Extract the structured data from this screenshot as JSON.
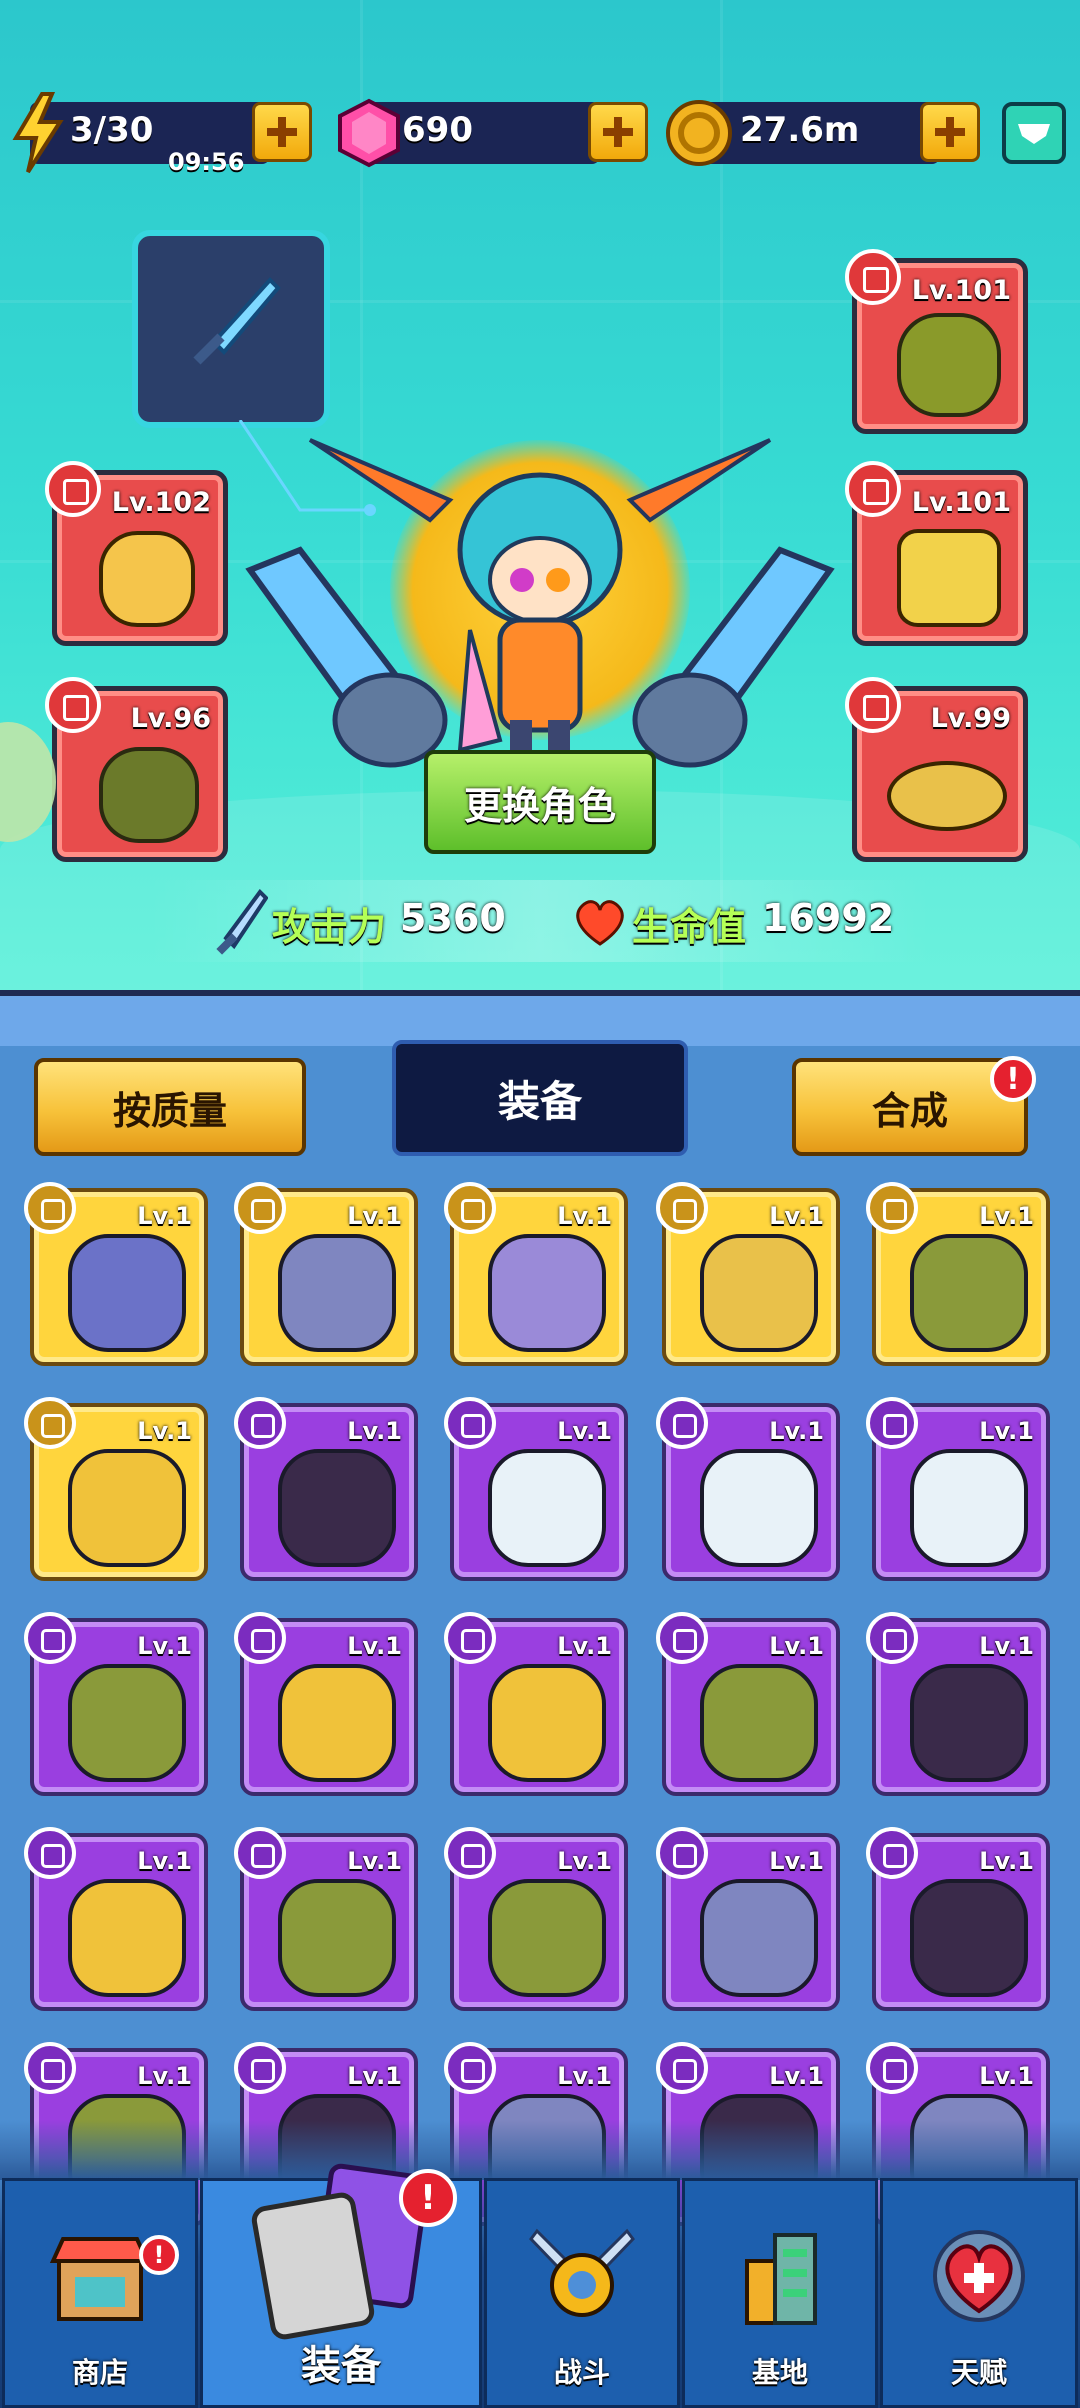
{
  "resources": {
    "energy": {
      "value": "3/30",
      "timer": "09:56",
      "icon": "lightning-icon"
    },
    "gems": {
      "value": "690",
      "icon": "gem-icon"
    },
    "coins": {
      "value": "27.6m",
      "icon": "coin-icon"
    }
  },
  "hero": {
    "weapon_slot_icon": "sword-icon",
    "equipped_slots": [
      {
        "slot": "necklace",
        "level": "Lv.102",
        "icon": "scarf-icon"
      },
      {
        "slot": "gloves",
        "level": "Lv.96",
        "icon": "glove-icon"
      },
      {
        "slot": "armor",
        "level": "Lv.101",
        "icon": "armor-icon"
      },
      {
        "slot": "pants",
        "level": "Lv.101",
        "icon": "shorts-icon"
      },
      {
        "slot": "shoes",
        "level": "Lv.99",
        "icon": "sandal-icon"
      }
    ],
    "change_button": "更换角色",
    "stats": {
      "attack_label": "攻击力",
      "attack_value": "5360",
      "hp_label": "生命值",
      "hp_value": "16992"
    }
  },
  "tabs": {
    "sort_button": "按质量",
    "current_tab": "装备",
    "merge_button": "合成",
    "merge_alert": "!"
  },
  "inventory": [
    {
      "level": "Lv.1",
      "rarity": "legendary",
      "icon": "pants-icon"
    },
    {
      "level": "Lv.1",
      "rarity": "legendary",
      "icon": "armor-icon"
    },
    {
      "level": "Lv.1",
      "rarity": "legendary",
      "icon": "gauntlet-icon"
    },
    {
      "level": "Lv.1",
      "rarity": "legendary",
      "icon": "shirt-icon"
    },
    {
      "level": "Lv.1",
      "rarity": "legendary",
      "icon": "boot-icon"
    },
    {
      "level": "Lv.1",
      "rarity": "legendary",
      "icon": "glove-icon"
    },
    {
      "level": "Lv.1",
      "rarity": "epic",
      "icon": "necklace-icon"
    },
    {
      "level": "Lv.1",
      "rarity": "epic",
      "icon": "vest-icon"
    },
    {
      "level": "Lv.1",
      "rarity": "epic",
      "icon": "sock-icon"
    },
    {
      "level": "Lv.1",
      "rarity": "epic",
      "icon": "sock-icon"
    },
    {
      "level": "Lv.1",
      "rarity": "epic",
      "icon": "boot-icon"
    },
    {
      "level": "Lv.1",
      "rarity": "epic",
      "icon": "glove-icon"
    },
    {
      "level": "Lv.1",
      "rarity": "epic",
      "icon": "glove-icon"
    },
    {
      "level": "Lv.1",
      "rarity": "epic",
      "icon": "boot-icon"
    },
    {
      "level": "Lv.1",
      "rarity": "epic",
      "icon": "necklace-icon"
    },
    {
      "level": "Lv.1",
      "rarity": "epic",
      "icon": "sandal-icon"
    },
    {
      "level": "Lv.1",
      "rarity": "epic",
      "icon": "boot-icon"
    },
    {
      "level": "Lv.1",
      "rarity": "epic",
      "icon": "boot-icon"
    },
    {
      "level": "Lv.1",
      "rarity": "epic",
      "icon": "armor-icon"
    },
    {
      "level": "Lv.1",
      "rarity": "epic",
      "icon": "necklace-icon"
    },
    {
      "level": "Lv.1",
      "rarity": "epic",
      "icon": "boot-icon"
    },
    {
      "level": "Lv.1",
      "rarity": "epic",
      "icon": "necklace-icon"
    },
    {
      "level": "Lv.1",
      "rarity": "epic",
      "icon": "armor-icon"
    },
    {
      "level": "Lv.1",
      "rarity": "epic",
      "icon": "necklace-icon"
    },
    {
      "level": "Lv.1",
      "rarity": "epic",
      "icon": "armor-icon"
    }
  ],
  "nav": {
    "shop": "商店",
    "equipment": "装备",
    "battle": "战斗",
    "base": "基地",
    "talent": "天赋",
    "alert": "!"
  }
}
